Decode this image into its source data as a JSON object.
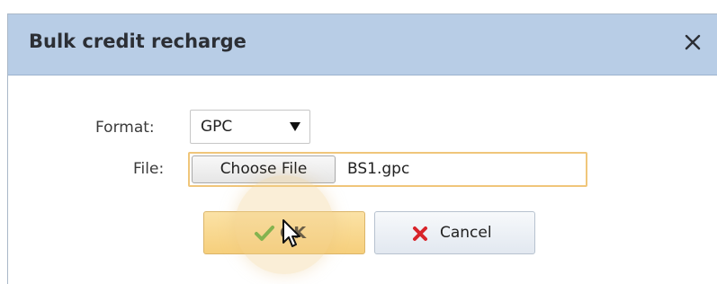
{
  "dialog": {
    "title": "Bulk credit recharge",
    "close_icon": "close-icon"
  },
  "form": {
    "format_label": "Format:",
    "format_value": "GPC",
    "format_arrow_icon": "caret-down-icon",
    "file_label": "File:",
    "choose_file_label": "Choose File",
    "file_name": "BS1.gpc"
  },
  "buttons": {
    "ok_label": "OK",
    "ok_icon": "checkmark-icon",
    "cancel_label": "Cancel",
    "cancel_icon": "red-x-icon"
  },
  "colors": {
    "titlebar": "#b8cde6",
    "ok_button": "#f6cf7c",
    "file_focus_border": "#f0c67a",
    "check_green": "#4aa52e",
    "cancel_red": "#d8242a"
  }
}
